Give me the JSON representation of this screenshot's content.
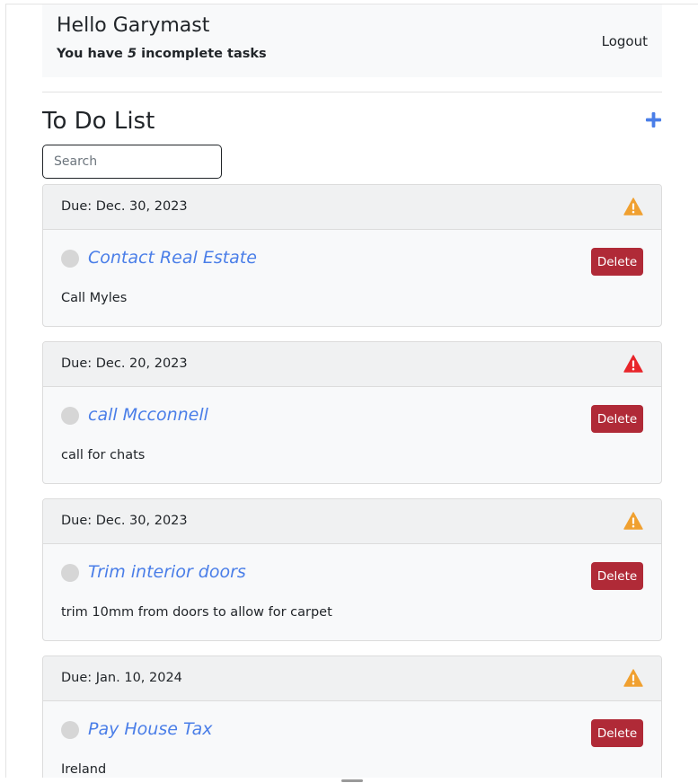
{
  "header": {
    "greeting": "Hello Garymast",
    "tasks_prefix": "You have ",
    "incomplete_count": "5",
    "tasks_suffix": " incomplete tasks",
    "logout_label": "Logout"
  },
  "list": {
    "title": "To Do List",
    "add_icon": "plus-icon",
    "search_placeholder": "Search"
  },
  "colors": {
    "accent": "#4a7ee8",
    "delete": "#b02a37",
    "warning_orange": "#f0a030",
    "warning_red": "#e8252a"
  },
  "tasks": [
    {
      "due": "Due: Dec. 30, 2023",
      "warning_icon": "warning-orange-icon",
      "title": "Contact Real Estate",
      "description": "Call Myles",
      "delete_label": "Delete"
    },
    {
      "due": "Due: Dec. 20, 2023",
      "warning_icon": "warning-red-icon",
      "title": "call Mcconnell",
      "description": "call for chats",
      "delete_label": "Delete"
    },
    {
      "due": "Due: Dec. 30, 2023",
      "warning_icon": "warning-orange-icon",
      "title": "Trim interior doors",
      "description": "trim 10mm from doors to allow for carpet",
      "delete_label": "Delete"
    },
    {
      "due": "Due: Jan. 10, 2024",
      "warning_icon": "warning-orange-icon",
      "title": "Pay House Tax",
      "description": "Ireland",
      "delete_label": "Delete"
    }
  ]
}
